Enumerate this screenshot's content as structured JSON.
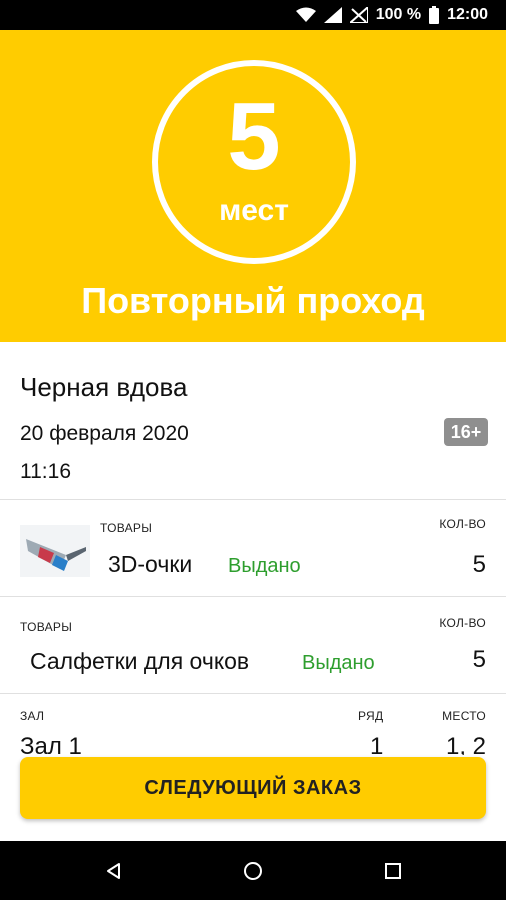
{
  "status_bar": {
    "battery": "100 %",
    "time": "12:00",
    "icons": [
      "wifi-icon",
      "signal-icon",
      "battery-icon"
    ]
  },
  "header": {
    "seats_count": "5",
    "seats_unit": "мест",
    "title": "Повторный проход",
    "background_color": "#FFCC00"
  },
  "movie": {
    "title": "Черная вдова",
    "date": "20 февраля 2020",
    "time": "11:16",
    "age_rating": "16+"
  },
  "goods": [
    {
      "label": "ТОВАРЫ",
      "qty_label": "КОЛ-ВО",
      "name": "3D-очки",
      "status": "Выдано",
      "qty": "5",
      "icon": "3d-glasses-image"
    },
    {
      "label": "ТОВАРЫ",
      "qty_label": "КОЛ-ВО",
      "name": "Салфетки для очков",
      "status": "Выдано",
      "qty": "5"
    }
  ],
  "hall": {
    "hall_label": "ЗАЛ",
    "row_label": "РЯД",
    "seat_label": "МЕСТО",
    "hall_value": "Зал 1",
    "row_value": "1",
    "seat_value": "1, 2"
  },
  "actions": {
    "next_order_label": "СЛЕДУЮЩИЙ ЗАКАЗ"
  },
  "colors": {
    "accent": "#FFCC00",
    "status_issued": "#2e9e2e"
  }
}
